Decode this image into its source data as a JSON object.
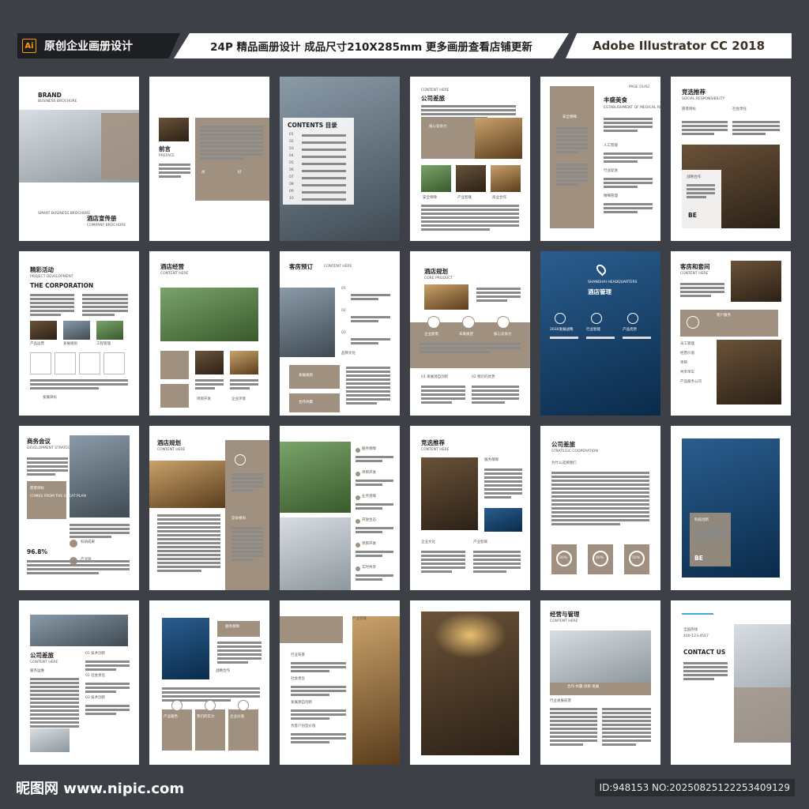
{
  "header": {
    "left": "原创企业画册设计",
    "ai": "Ai",
    "center": "24P 精品画册设计 成品尺寸210X285mm 更多画册查看店铺更新",
    "right": "Adobe Illustrator CC 2018"
  },
  "footer": {
    "site": "昵图网 www.nipic.com",
    "id": "ID:948153 NO:20250825122253409129"
  },
  "accent": "#a09080",
  "pages": [
    {
      "title": "BRAND",
      "subtitle": "BUSINESS BROCHURE",
      "sub2": "SMART BUSINESS BROCHURE",
      "cn": "酒店宣传册",
      "cn_sub": "COMPANY BROCHURE"
    },
    {
      "title": "前言",
      "subtitle": "PREFACE",
      "l1": "尚",
      "l2": "好"
    },
    {
      "title": "CONTENTS 目录",
      "items": [
        "01",
        "02",
        "03",
        "04",
        "05",
        "06",
        "07",
        "08",
        "09",
        "10"
      ]
    },
    {
      "title": "CONTENT HERE",
      "subtitle": "公司差旅",
      "l1": "核心竞争力",
      "labels": [
        "安全保障",
        "产业智联",
        "商业合作"
      ]
    },
    {
      "title": "丰盛美食",
      "subtitle": "ESTABLISHMENT OF MEDICAL RECORDS",
      "page": "PAGE 01/02",
      "l1": "安全保障",
      "items": [
        "人工智能",
        "行业促进",
        "精细管理"
      ]
    },
    {
      "title": "竞选推荐",
      "subtitle": "SOCIAL RESPONSIBILITY",
      "items": [
        "愿景目标",
        "社会责任",
        "战略合作"
      ],
      "logo": "BE"
    },
    {
      "title": "精彩活动",
      "subtitle": "PROJECT DEVELOPMENT",
      "sub2": "THE CORPORATION",
      "items": [
        "产品运营",
        "发展规划",
        "工程管理"
      ],
      "foot": "发展目标"
    },
    {
      "title": "酒店经营",
      "subtitle": "CONTENT HERE",
      "items": [
        "项目开发",
        "企业环境"
      ]
    },
    {
      "title": "客房预订",
      "subtitle": "CONTENT HERE",
      "items": [
        "01",
        "02",
        "03"
      ],
      "l1": "发展规划",
      "l2": "合作共赢",
      "l3": "品牌文化"
    },
    {
      "title": "酒店规划",
      "subtitle": "CORE PRODUCT",
      "items": [
        "企业愿景",
        "未来展望",
        "核心竞争力"
      ],
      "l1": "01 发展源自创新",
      "l2": "02 我们的优势"
    },
    {
      "title": "酒店管理",
      "subtitle": "SHANGHAI HEADQUARTERS",
      "items": [
        "2030发展战略",
        "行业智能",
        "产品优势"
      ]
    },
    {
      "title": "客房和套间",
      "subtitle": "CONTENT HERE",
      "l1": "客户服务",
      "items": [
        "员工管理",
        "经营价值",
        "项目",
        "共享单车",
        "产品服务公司"
      ]
    },
    {
      "title": "商务会议",
      "subtitle": "DEVELOPMENT STRATEGY",
      "l1": "愿景目标",
      "l2": "COMES FROM THE GREAT PLAN",
      "stat": "96.8%",
      "items": [
        "科研成果",
        "产业链"
      ]
    },
    {
      "title": "酒店规划",
      "subtitle": "CONTENT HERE",
      "l1": "竞争格局"
    },
    {
      "title": "",
      "items": [
        "服务保障",
        "项目开发",
        "业务领域",
        "开放生态",
        "项目开发",
        "实时共享"
      ]
    },
    {
      "title": "竞选推荐",
      "subtitle": "CONTENT HERE",
      "l1": "服务保障",
      "items": [
        "企业文化",
        "产业智联"
      ]
    },
    {
      "title": "公司差旅",
      "subtitle": "STRATEGIC COOPERATION",
      "l1": "为什么选择我们",
      "items": [
        "20%",
        "40%",
        "50%"
      ]
    },
    {
      "title": "",
      "l1": "科技创新",
      "logo": "BE"
    },
    {
      "title": "公司差旅",
      "subtitle": "CONTENT HERE",
      "l1": "服务运维",
      "items": [
        "01 技术创新",
        "02 社会责任",
        "03 技术创新"
      ]
    },
    {
      "title": "",
      "l1": "服务保障",
      "l2": "战略合作",
      "items": [
        "产业服务",
        "我们的实力",
        "企业价值"
      ]
    },
    {
      "title": "",
      "l1": "产业智联",
      "items": [
        "行业背景",
        "社会责任",
        "发展源自创新",
        "为客户创造价值"
      ]
    },
    {
      "title": ""
    },
    {
      "title": "经营与管理",
      "subtitle": "CONTENT HERE",
      "l1": "合作·共赢·创新·发展",
      "l2": "行业发展前景"
    },
    {
      "title": "CONTACT US",
      "items": [
        "全国热线",
        "400-123-4567"
      ]
    }
  ]
}
